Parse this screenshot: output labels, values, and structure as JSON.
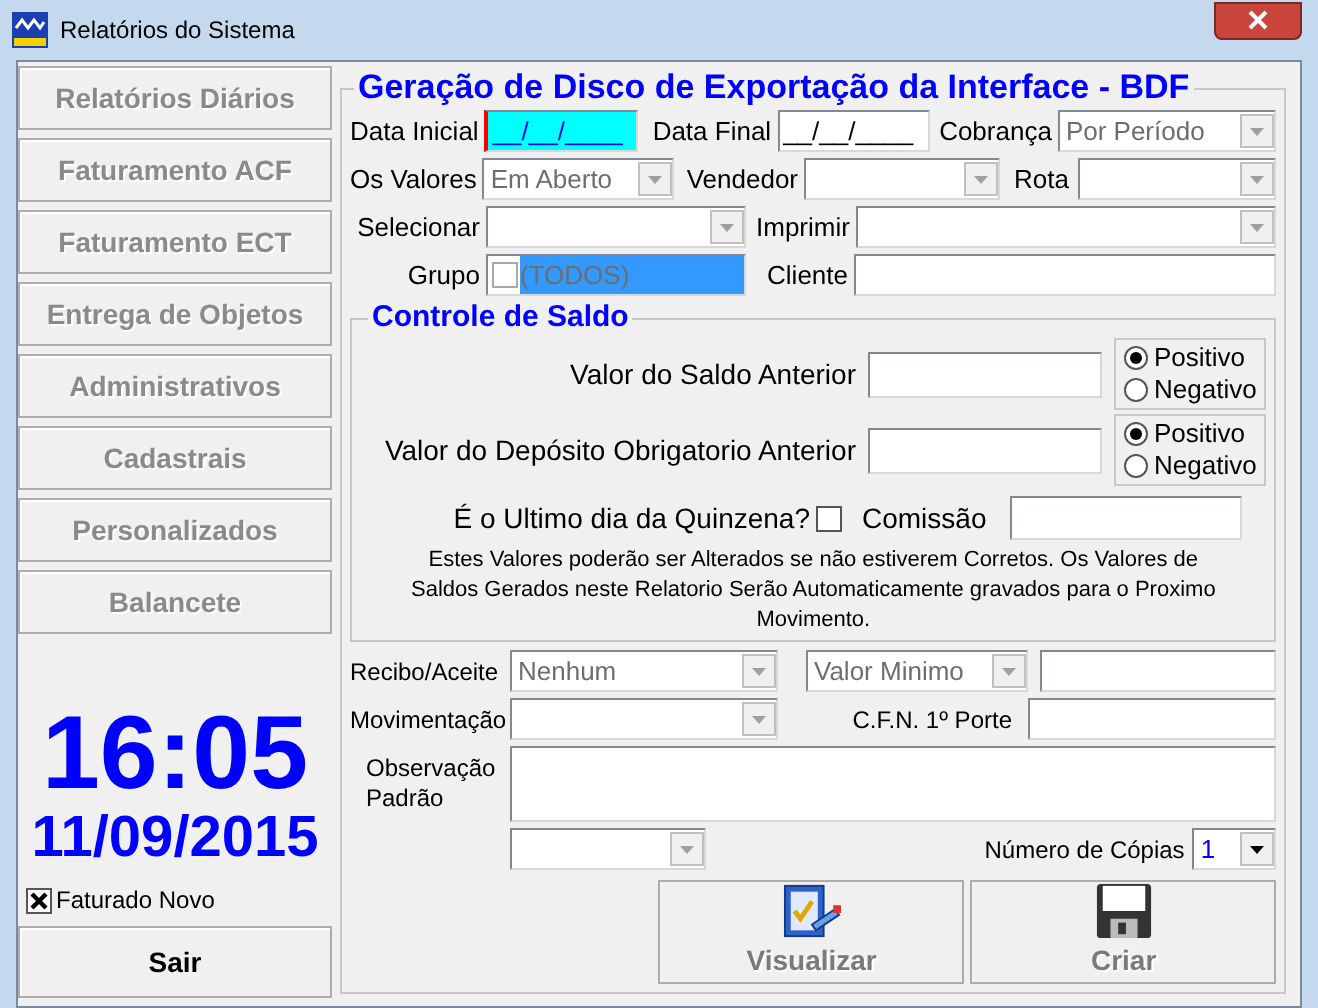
{
  "window": {
    "title": "Relatórios do Sistema"
  },
  "sidebar": {
    "buttons": [
      {
        "label": "Relatórios Diários",
        "disabled": true
      },
      {
        "label": "Faturamento ACF",
        "disabled": true
      },
      {
        "label": "Faturamento ECT",
        "disabled": true
      },
      {
        "label": "Entrega de Objetos",
        "disabled": true
      },
      {
        "label": "Administrativos",
        "disabled": true
      },
      {
        "label": "Cadastrais",
        "disabled": true
      },
      {
        "label": "Personalizados",
        "disabled": true
      },
      {
        "label": "Balancete",
        "disabled": true
      }
    ],
    "clock": {
      "time": "16:05",
      "date": "11/09/2015"
    },
    "faturado_novo": {
      "label": "Faturado Novo",
      "checked": true
    },
    "exit_button": {
      "label": "Sair",
      "disabled": false
    }
  },
  "export": {
    "title": "Geração de Disco de Exportação da Interface - BDF",
    "data_inicial": {
      "label": "Data Inicial",
      "value": "__/__/____",
      "focused": true
    },
    "data_final": {
      "label": "Data Final",
      "value": "__/__/____",
      "focused": false
    },
    "cobranca": {
      "label": "Cobrança",
      "value": "Por Período",
      "disabled": true
    },
    "os_valores": {
      "label": "Os Valores",
      "value": "Em Aberto",
      "disabled": true
    },
    "vendedor": {
      "label": "Vendedor",
      "disabled": true
    },
    "rota": {
      "label": "Rota",
      "disabled": true
    },
    "selecionar": {
      "label": "Selecionar",
      "disabled": true
    },
    "imprimir": {
      "label": "Imprimir",
      "disabled": true
    },
    "grupo": {
      "label": "Grupo",
      "item": {
        "label": "(TODOS)",
        "checked": false,
        "selected": true
      }
    },
    "cliente": {
      "label": "Cliente"
    },
    "saldo": {
      "title": "Controle de Saldo",
      "rows": [
        {
          "label": "Valor do Saldo Anterior",
          "options": [
            {
              "label": "Positivo",
              "selected": true
            },
            {
              "label": "Negativo",
              "selected": false
            }
          ]
        },
        {
          "label": "Valor do Depósito Obrigatorio Anterior",
          "options": [
            {
              "label": "Positivo",
              "selected": true
            },
            {
              "label": "Negativo",
              "selected": false
            }
          ]
        }
      ],
      "quinzena": {
        "label": "É o Ultimo dia da Quinzena?",
        "checked": false
      },
      "comissao": {
        "label": "Comissão"
      },
      "note": "Estes Valores poderão ser Alterados se não estiverem Corretos. Os Valores de Saldos Gerados neste Relatorio Serão Automaticamente gravados para o Proximo Movimento."
    },
    "recibo": {
      "label": "Recibo/Aceite",
      "value": "Nenhum",
      "disabled": true
    },
    "valor_minimo": {
      "value": "Valor Minimo",
      "disabled": true
    },
    "movimentacao": {
      "label": "Movimentação",
      "disabled": true
    },
    "cfn": {
      "label": "C.F.N. 1º Porte"
    },
    "observacao": {
      "label": "Observação Padrão"
    },
    "select_4": {
      "disabled": true
    },
    "copias": {
      "label": "Número de Cópias",
      "value": "1",
      "disabled": false
    },
    "actions": [
      {
        "label": "Visualizar",
        "kind": "preview",
        "disabled": true
      },
      {
        "label": "Criar",
        "kind": "save",
        "disabled": true
      }
    ]
  }
}
